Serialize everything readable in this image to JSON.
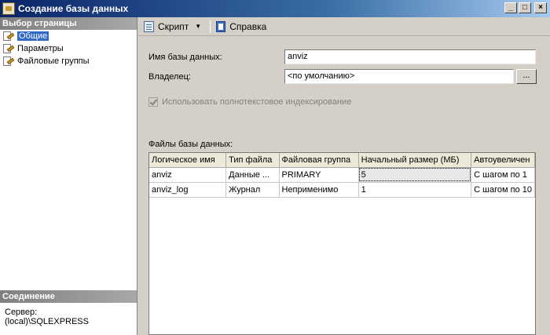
{
  "window": {
    "title": "Создание базы данных"
  },
  "left_panel": {
    "header": "Выбор страницы",
    "items": [
      {
        "label": "Общие",
        "selected": true
      },
      {
        "label": "Параметры",
        "selected": false
      },
      {
        "label": "Файловые группы",
        "selected": false
      }
    ],
    "connection": {
      "header": "Соединение",
      "server_label": "Сервер:",
      "server_value": "(local)\\SQLEXPRESS"
    }
  },
  "toolbar": {
    "script_label": "Скрипт",
    "help_label": "Справка"
  },
  "form": {
    "dbname_label": "Имя базы данных:",
    "dbname_value": "anviz",
    "owner_label": "Владелец:",
    "owner_value": "<по умолчанию>",
    "owner_button": "...",
    "fulltext_label": "Использовать полнотекстовое индексирование",
    "files_label": "Файлы базы данных:"
  },
  "files_table": {
    "columns": [
      "Логическое имя",
      "Тип файла",
      "Файловая группа",
      "Начальный размер (МБ)",
      "Автоувеличен"
    ],
    "rows": [
      [
        "anviz",
        "Данные ...",
        "PRIMARY",
        "5",
        "С шагом по 1"
      ],
      [
        "anviz_log",
        "Журнал",
        "Неприменимо",
        "1",
        "С шагом по 10"
      ]
    ]
  },
  "colors": {
    "title_start": "#0a246a",
    "title_end": "#a6caf0",
    "selection": "#316ac5"
  }
}
